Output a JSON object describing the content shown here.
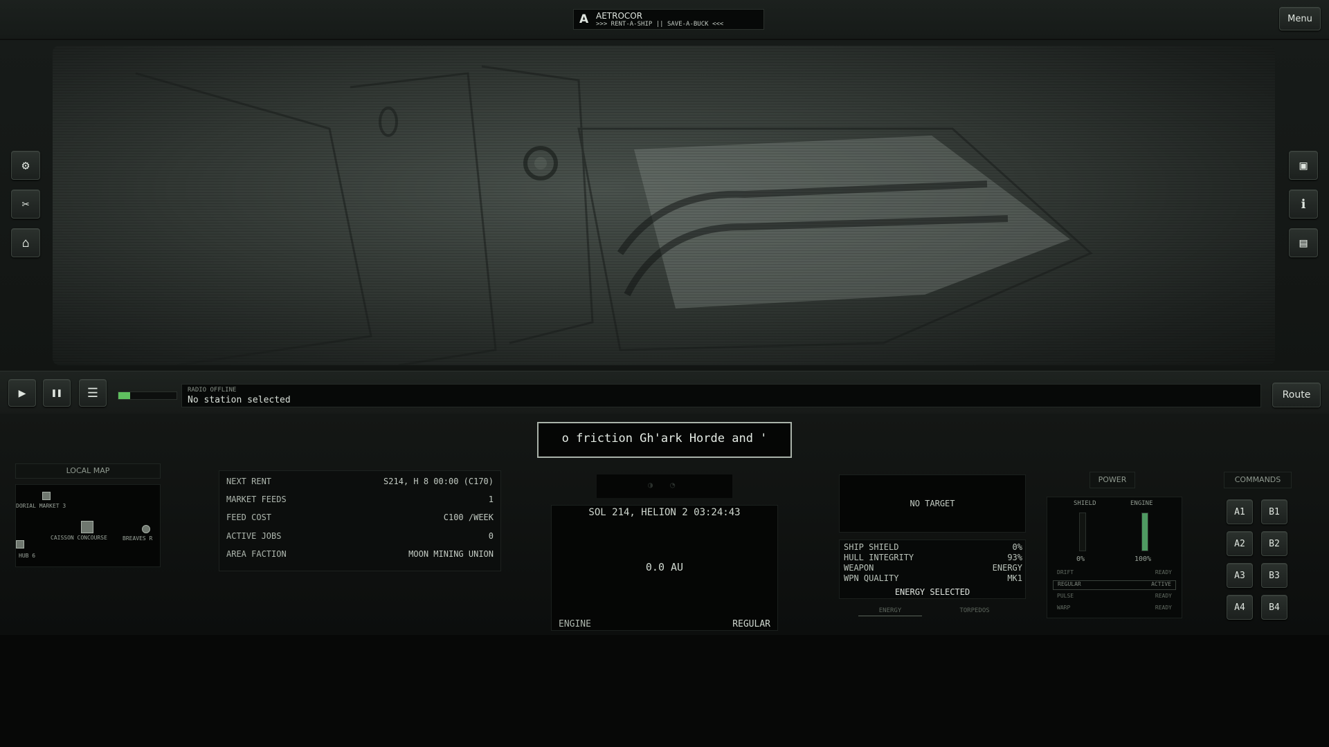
{
  "header": {
    "logo_glyph": "A",
    "brand_name": "AETROCOR",
    "tagline": ">>> RENT-A-SHIP || SAVE-A-BUCK <<<",
    "menu_label": "Menu"
  },
  "left_tools": [
    {
      "name": "settings",
      "icon": "gear-icon",
      "glyph": "⚙"
    },
    {
      "name": "tools",
      "icon": "tools-icon",
      "glyph": "✂"
    },
    {
      "name": "market",
      "icon": "store-icon",
      "glyph": "⌂"
    }
  ],
  "right_tools": [
    {
      "name": "cargo",
      "icon": "cargo-icon",
      "glyph": "▣"
    },
    {
      "name": "info",
      "icon": "info-icon",
      "glyph": "ℹ"
    },
    {
      "name": "chat",
      "icon": "chat-icon",
      "glyph": "▤"
    }
  ],
  "controls": {
    "play_glyph": "▶",
    "pause_glyph": "❚❚",
    "list_glyph": "☰",
    "signal_level": 0.2,
    "signal_color": "#5fbf5f",
    "route_label": "Route"
  },
  "radio": {
    "status": "RADIO OFFLINE",
    "message": "No station selected"
  },
  "ticker": "o friction Gh'ark Horde and '",
  "local_map": {
    "title": "LOCAL MAP",
    "labels": [
      "DORIAL MARKET 3",
      "CAISSON CONCOURSE",
      "BREAVES R",
      "HUB 6"
    ]
  },
  "info": {
    "rows": [
      {
        "label": "NEXT RENT",
        "value": "S214, H 8 00:00 (C170)"
      },
      {
        "label": "MARKET FEEDS",
        "value": "1"
      },
      {
        "label": "FEED COST",
        "value": "C100 /WEEK"
      },
      {
        "label": "ACTIVE JOBS",
        "value": "0"
      },
      {
        "label": "AREA FACTION",
        "value": "MOON MINING UNION"
      }
    ]
  },
  "nav": {
    "top_glyphs": [
      "◑",
      "◔"
    ],
    "date": "SOL 214, HELION 2 03:24:43",
    "distance": "0.0 AU",
    "engine_label": "ENGINE",
    "engine_mode": "REGULAR"
  },
  "target": {
    "label": "NO TARGET",
    "stats": [
      {
        "label": "SHIP SHIELD",
        "value": "0%"
      },
      {
        "label": "HULL INTEGRITY",
        "value": "93%"
      },
      {
        "label": "WEAPON",
        "value": "ENERGY"
      },
      {
        "label": "WPN QUALITY",
        "value": "MK1"
      }
    ],
    "weapon_selected": "ENERGY SELECTED",
    "tabs": [
      "ENERGY",
      "TORPEDOS"
    ]
  },
  "power": {
    "title": "POWER",
    "shield_label": "SHIELD",
    "engine_label": "ENGINE",
    "shield_level": 0,
    "engine_level": 1,
    "shield_value": "0%",
    "engine_value": "100%",
    "modes": [
      {
        "name": "DRIFT",
        "status": "READY"
      },
      {
        "name": "REGULAR",
        "status": "ACTIVE"
      },
      {
        "name": "PULSE",
        "status": "READY"
      },
      {
        "name": "WARP",
        "status": "READY"
      }
    ]
  },
  "commands": {
    "title": "COMMANDS",
    "buttons": [
      "A1",
      "B1",
      "A2",
      "B2",
      "A3",
      "B3",
      "A4",
      "B4"
    ]
  }
}
